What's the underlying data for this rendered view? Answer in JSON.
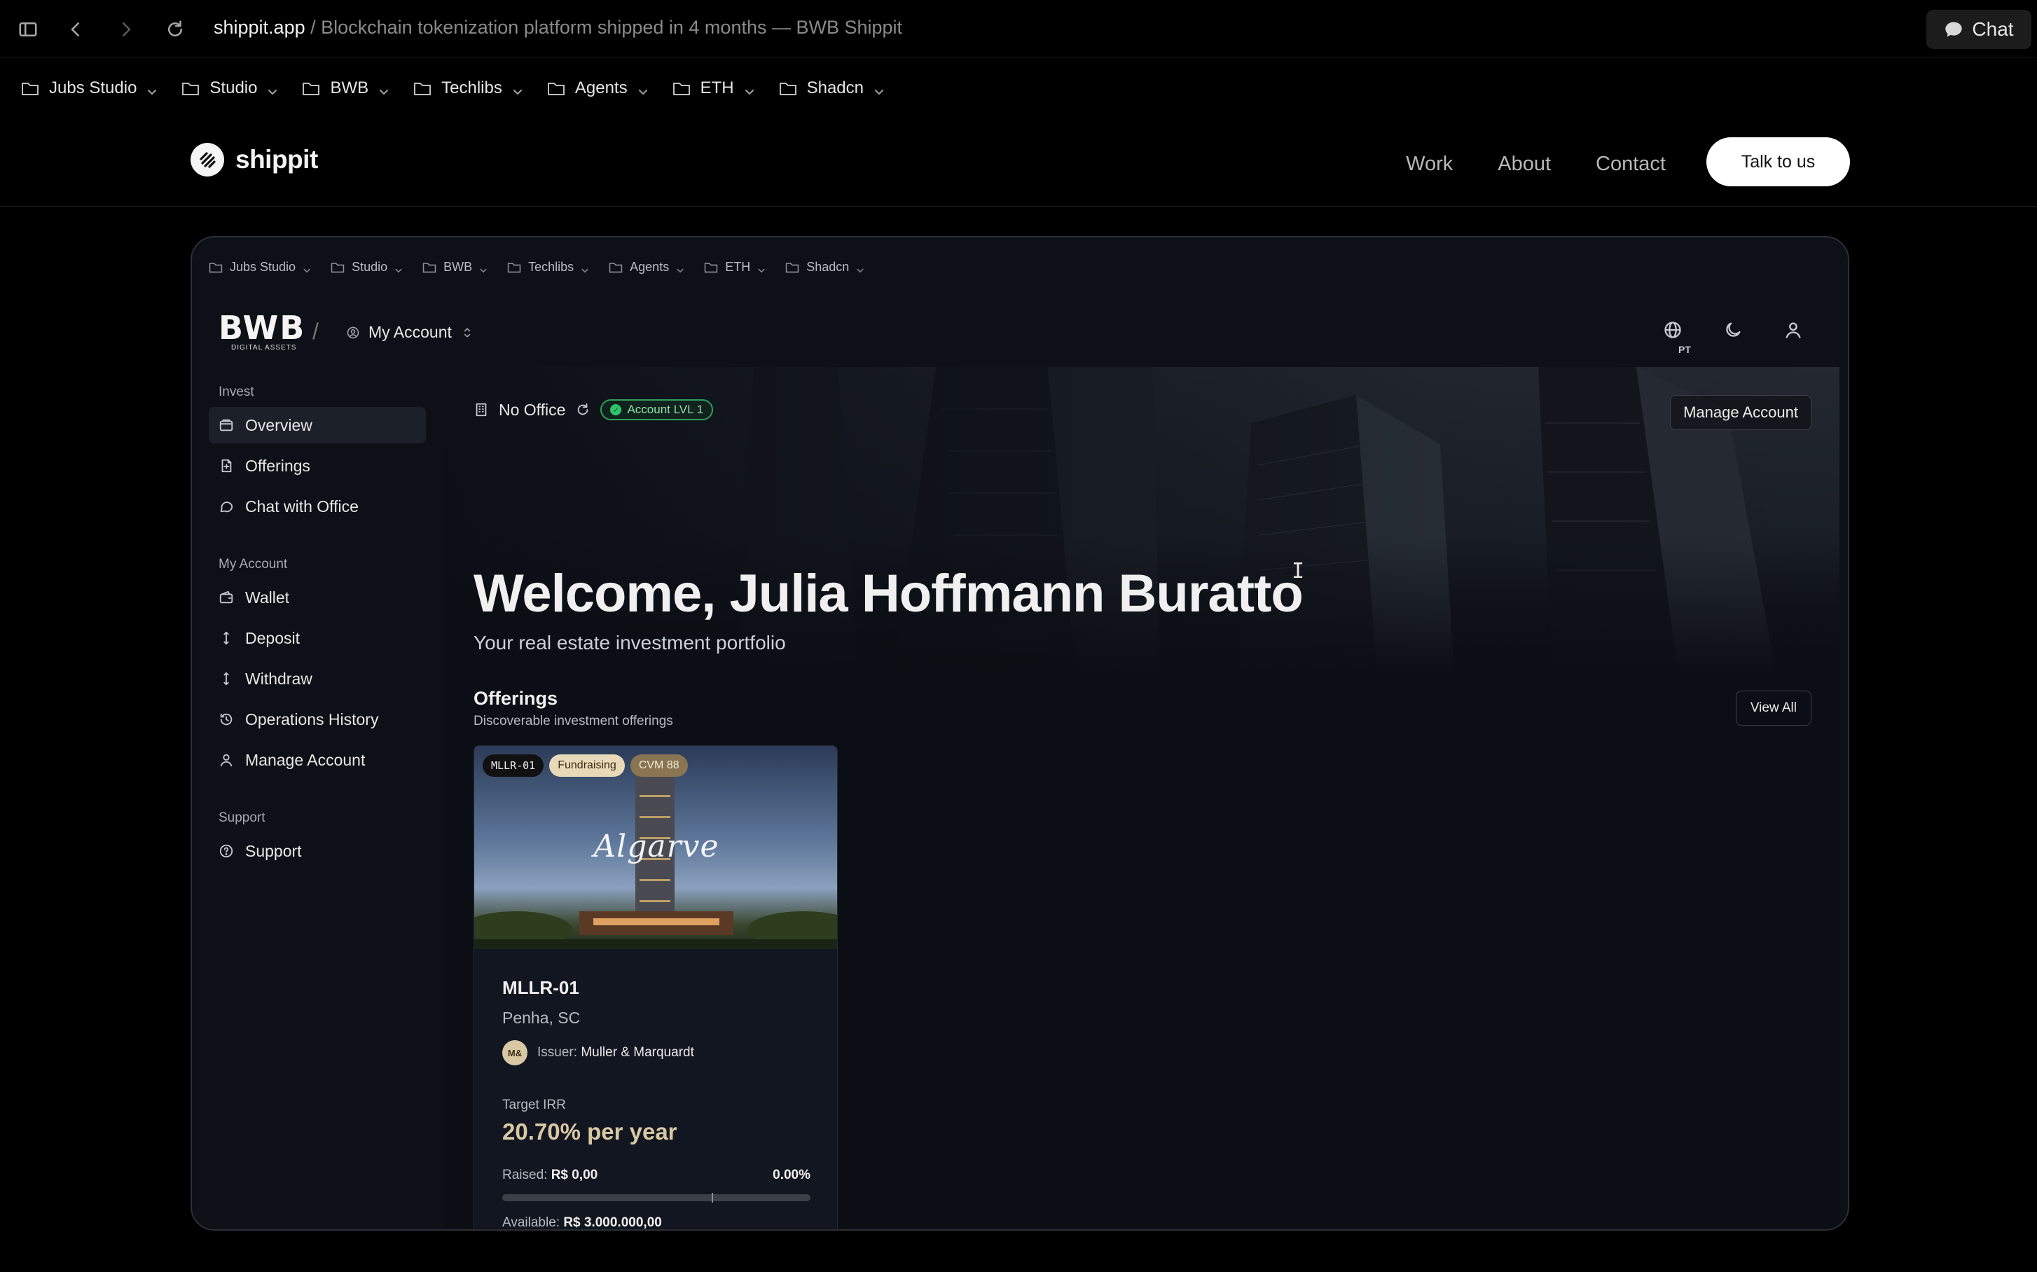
{
  "browser": {
    "host": "shippit.app",
    "path": " / Blockchain tokenization platform shipped in 4 months — BWB Shippit",
    "chat_label": "Chat"
  },
  "bookmarks": [
    "Jubs Studio",
    "Studio",
    "BWB",
    "Techlibs",
    "Agents",
    "ETH",
    "Shadcn"
  ],
  "site": {
    "logo_text": "shippit",
    "nav": [
      "Work",
      "About",
      "Contact"
    ],
    "cta": "Talk to us"
  },
  "app": {
    "bookmarks": [
      "Jubs Studio",
      "Studio",
      "BWB",
      "Techlibs",
      "Agents",
      "ETH",
      "Shadcn"
    ],
    "brand": "BWB",
    "brand_sub": "DIGITAL ASSETS",
    "slash": "/",
    "account_switch": "My Account",
    "lang": "PT",
    "sidebar": {
      "invest_label": "Invest",
      "invest": [
        "Overview",
        "Offerings",
        "Chat with Office"
      ],
      "account_label": "My Account",
      "account": [
        "Wallet",
        "Deposit",
        "Withdraw",
        "Operations History",
        "Manage Account"
      ],
      "support_label": "Support",
      "support": [
        "Support"
      ]
    },
    "status": {
      "office": "No Office",
      "level": "Account LVL 1",
      "level_color": "#30c36a"
    },
    "manage_account": "Manage Account",
    "welcome": "Welcome, Julia Hoffmann Buratto",
    "welcome_sub": "Your real estate investment portfolio",
    "offerings": {
      "title": "Offerings",
      "subtitle": "Discoverable investment offerings",
      "view_all": "View All"
    },
    "card": {
      "tag_code": "MLLR-01",
      "tag_status": "Fundraising",
      "tag_cvm": "CVM 88",
      "brand_word": "Algarve",
      "title": "MLLR-01",
      "location": "Penha, SC",
      "issuer_initials": "M&",
      "issuer_label": "Issuer:",
      "issuer_name": "Muller & Marquardt",
      "irr_label": "Target IRR",
      "irr_value": "20.70% per year",
      "raised_label": "Raised:",
      "raised_value": "R$ 0,00",
      "raised_percent": "0.00%",
      "progress_fraction": 0.0,
      "available_label": "Available:",
      "available_value": "R$ 3.000.000,00",
      "accent_color": "#d8c8a4"
    }
  }
}
